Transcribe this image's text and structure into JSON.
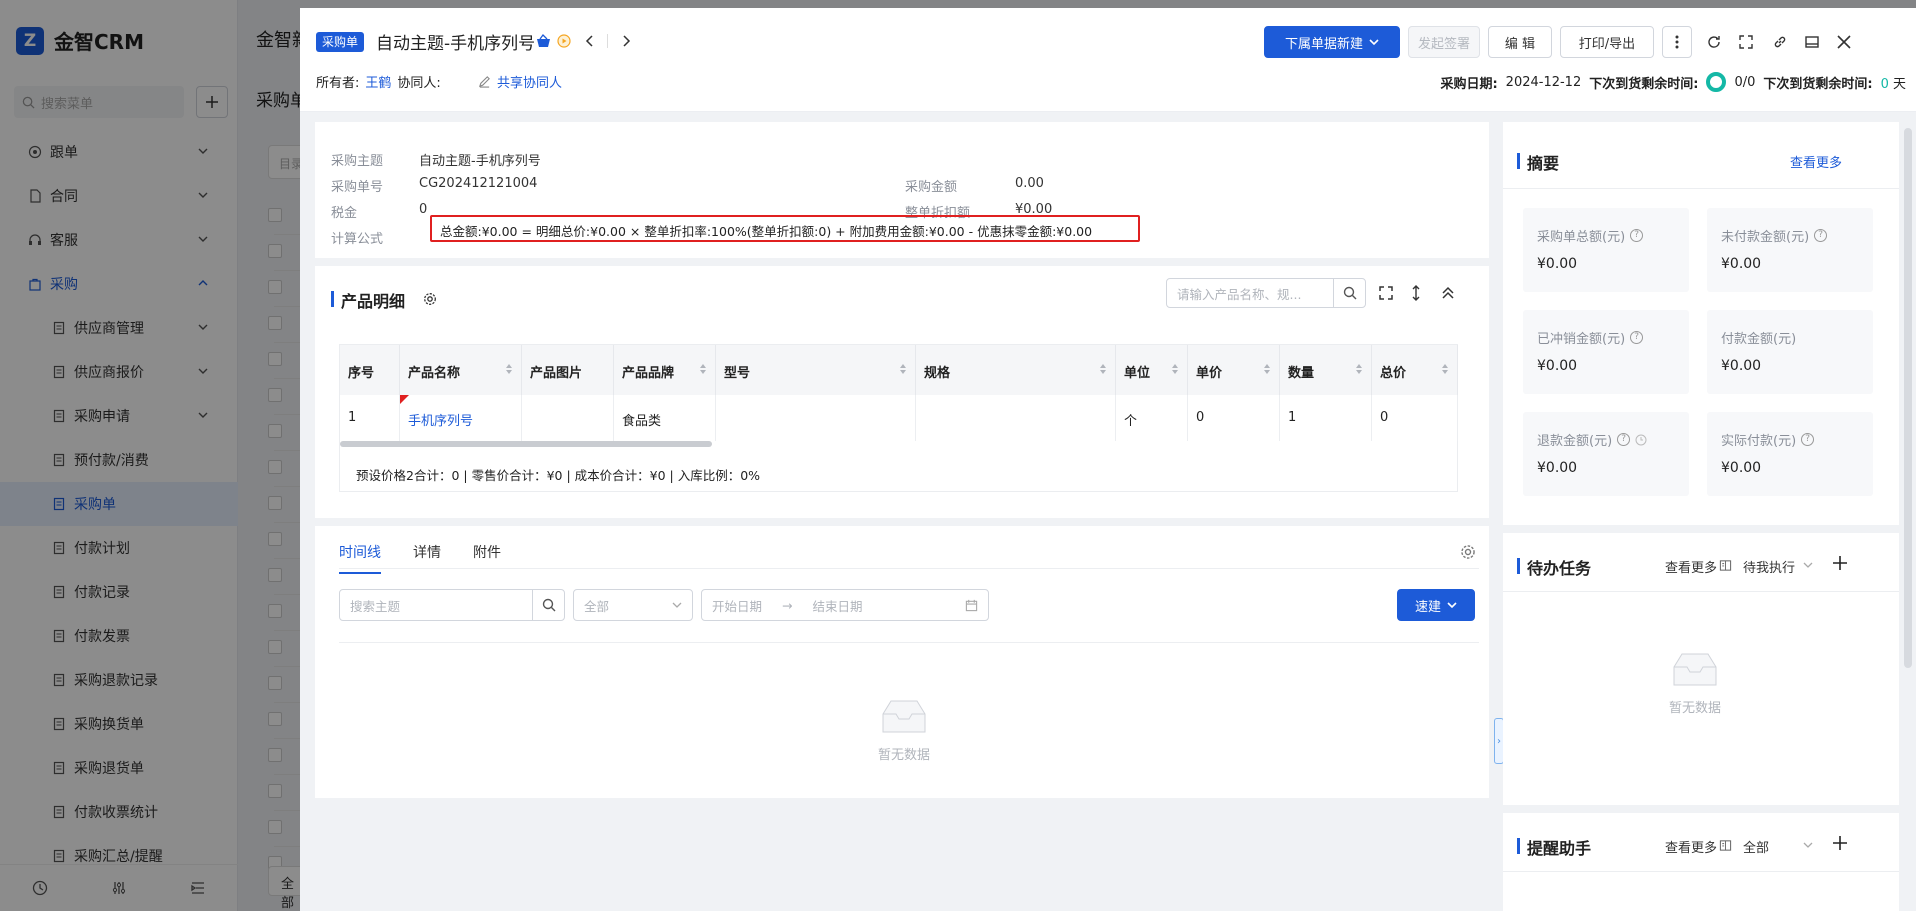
{
  "app": {
    "logo_mark": "Z",
    "logo": "金智CRM",
    "search_placeholder": "搜索菜单",
    "menu": [
      {
        "label": "跟单",
        "icon": "target-icon"
      },
      {
        "label": "合同",
        "icon": "document-icon"
      },
      {
        "label": "客服",
        "icon": "headset-icon"
      },
      {
        "label": "采购",
        "icon": "bag-icon"
      }
    ],
    "submenu": [
      {
        "label": "供应商管理",
        "has_chevron": true
      },
      {
        "label": "供应商报价",
        "has_chevron": true
      },
      {
        "label": "采购申请",
        "has_chevron": true
      },
      {
        "label": "预付款/消费",
        "has_chevron": false
      },
      {
        "label": "采购单",
        "has_chevron": false,
        "active": true
      },
      {
        "label": "付款计划",
        "has_chevron": false
      },
      {
        "label": "付款记录",
        "has_chevron": false
      },
      {
        "label": "付款发票",
        "has_chevron": false
      },
      {
        "label": "采购退款记录",
        "has_chevron": false
      },
      {
        "label": "采购换货单",
        "has_chevron": false
      },
      {
        "label": "采购退货单",
        "has_chevron": false
      },
      {
        "label": "付款收票统计",
        "has_chevron": false
      },
      {
        "label": "采购汇总/提醒",
        "has_chevron": false
      }
    ],
    "bg_tab": "金智新",
    "bg_title": "采购单",
    "bg_filter": "目录",
    "bg_button": "全部"
  },
  "drawer": {
    "tag": "采购单",
    "title": "自动主题-手机序列号",
    "owner_label": "所有者:",
    "owner": "王鹤",
    "collab_label": "协同人:",
    "share": "共享协同人",
    "buttons": {
      "new_child": "下属单据新建",
      "sign": "发起签署",
      "edit": "编 辑",
      "print": "打印/导出"
    },
    "purchase_date_label": "采购日期:",
    "purchase_date": "2024-12-12",
    "next_arrival_label": "下次到货剩余时间:",
    "progress": "0/0",
    "next_arrival_label2": "下次到货剩余时间:",
    "days": "0",
    "days_unit": "天"
  },
  "info": {
    "subject_label": "采购主题",
    "subject": "自动主题-手机序列号",
    "order_no_label": "采购单号",
    "order_no": "CG202412121004",
    "amount_label": "采购金额",
    "amount": "0.00",
    "tax_label": "税金",
    "tax": "0",
    "discount_label": "整单折扣额",
    "discount": "¥0.00",
    "formula_label": "计算公式",
    "formula": "总金额:¥0.00 = 明细总价:¥0.00 × 整单折扣率:100%(整单折扣额:0) + 附加费用金额:¥0.00 - 优惠抹零金额:¥0.00"
  },
  "products": {
    "title": "产品明细",
    "search_placeholder": "请输入产品名称、规...",
    "columns": [
      "序号",
      "产品名称",
      "产品图片",
      "产品品牌",
      "型号",
      "规格",
      "单位",
      "单价",
      "数量",
      "总价"
    ],
    "rows": [
      [
        "1",
        "手机序列号",
        "",
        "食品类",
        "",
        "",
        "个",
        "0",
        "1",
        "0"
      ]
    ],
    "footer": "预设价格2合计：0 |   零售价合计：¥0 |   成本价合计：¥0 |   入库比例：0%"
  },
  "timeline": {
    "tabs": [
      "时间线",
      "详情",
      "附件"
    ],
    "search_placeholder": "搜索主题",
    "filter": "全部",
    "start_date": "开始日期",
    "arrow": "→",
    "end_date": "结束日期",
    "quick_new": "速建",
    "empty": "暂无数据"
  },
  "summary": {
    "title": "摘要",
    "more": "查看更多",
    "items": [
      {
        "label": "采购单总额(元)",
        "value": "¥0.00"
      },
      {
        "label": "未付款金额(元)",
        "value": "¥0.00"
      },
      {
        "label": "已冲销金额(元)",
        "value": "¥0.00"
      },
      {
        "label": "付款金额(元)",
        "value": "¥0.00"
      },
      {
        "label": "退款金额(元)",
        "value": "¥0.00"
      },
      {
        "label": "实际付款(元)",
        "value": "¥0.00"
      }
    ]
  },
  "tasks": {
    "title": "待办任务",
    "more": "查看更多",
    "filter": "待我执行",
    "empty": "暂无数据"
  },
  "reminder": {
    "title": "提醒助手",
    "more": "查看更多",
    "filter": "全部"
  },
  "colors": {
    "primary": "#1d5bd8",
    "highlight": "#e02020",
    "teal": "#14b8a6"
  }
}
